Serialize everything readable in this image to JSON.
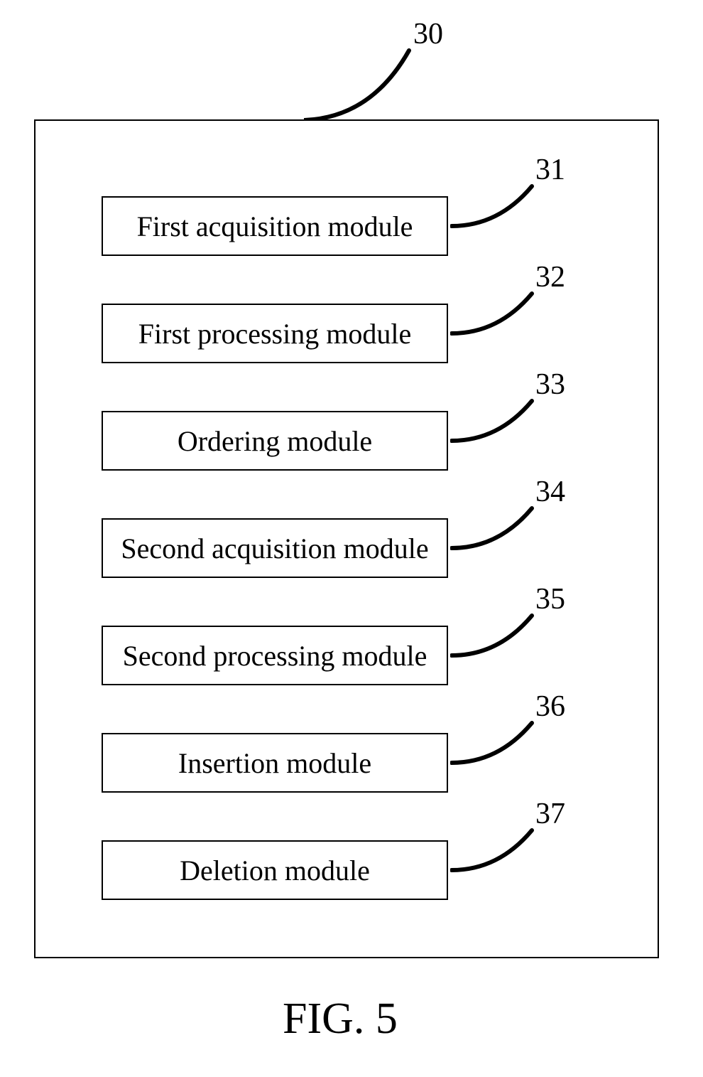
{
  "container": {
    "ref": "30"
  },
  "modules": [
    {
      "label": "First acquisition module",
      "ref": "31"
    },
    {
      "label": "First processing module",
      "ref": "32"
    },
    {
      "label": "Ordering module",
      "ref": "33"
    },
    {
      "label": "Second acquisition module",
      "ref": "34"
    },
    {
      "label": "Second processing module",
      "ref": "35"
    },
    {
      "label": "Insertion module",
      "ref": "36"
    },
    {
      "label": "Deletion module",
      "ref": "37"
    }
  ],
  "figure_label": "FIG. 5"
}
